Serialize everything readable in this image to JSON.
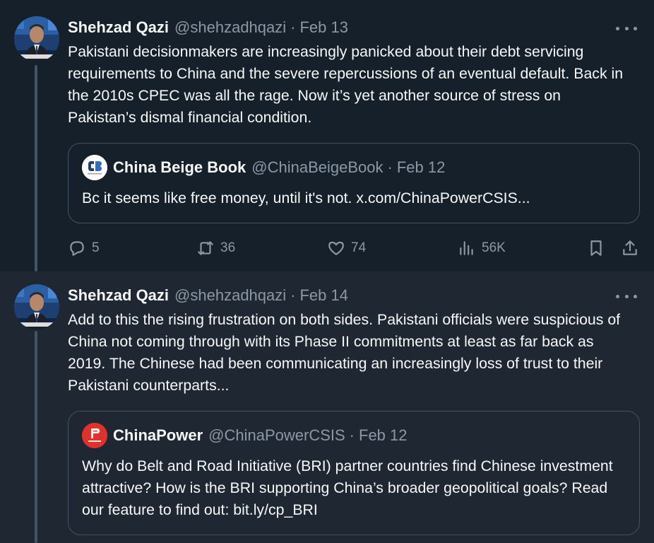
{
  "tweets": [
    {
      "author_name": "Shehzad Qazi",
      "author_handle": "@shehzadhqazi",
      "separator": "·",
      "date": "Feb 13",
      "text": "Pakistani decisionmakers are increasingly panicked about their debt servicing requirements to China and the severe repercussions of an eventual default. Back in the 2010s CPEC was all the rage. Now it’s yet another source of stress on Pakistan’s dismal financial condition.",
      "quote": {
        "author_name": "China Beige Book",
        "author_handle": "@ChinaBeigeBook",
        "separator": "·",
        "date": "Feb 12",
        "text": "Bc it seems like free money, until it's not. x.com/ChinaPowerCSIS..."
      },
      "actions": {
        "replies": "5",
        "reposts": "36",
        "likes": "74",
        "views": "56K"
      }
    },
    {
      "author_name": "Shehzad Qazi",
      "author_handle": "@shehzadhqazi",
      "separator": "·",
      "date": "Feb 14",
      "text": "Add to this the rising frustration on both sides. Pakistani officials were suspicious of China not coming through with its  Phase II commitments at least as far back as 2019. The Chinese had been communicating an increasingly loss of trust to their Pakistani counterparts...",
      "quote": {
        "author_name": "ChinaPower",
        "author_handle": "@ChinaPowerCSIS",
        "separator": "·",
        "date": "Feb 12",
        "text": "Why do Belt and Road Initiative (BRI) partner countries find Chinese investment attractive? How is the BRI supporting China’s broader geopolitical goals? Read our feature to find out: bit.ly/cp_BRI"
      }
    }
  ],
  "icons": {
    "reply": "reply-icon",
    "repost": "repost-icon",
    "like": "like-icon",
    "views": "views-icon",
    "bookmark": "bookmark-icon",
    "share": "share-icon",
    "more": "more-icon"
  },
  "colors": {
    "background": "#15202b",
    "background_hover": "#1e2732",
    "text": "#f7f9f9",
    "secondary_text": "#8b98a5",
    "border": "#425364",
    "chinapower_red": "#e0312c"
  }
}
